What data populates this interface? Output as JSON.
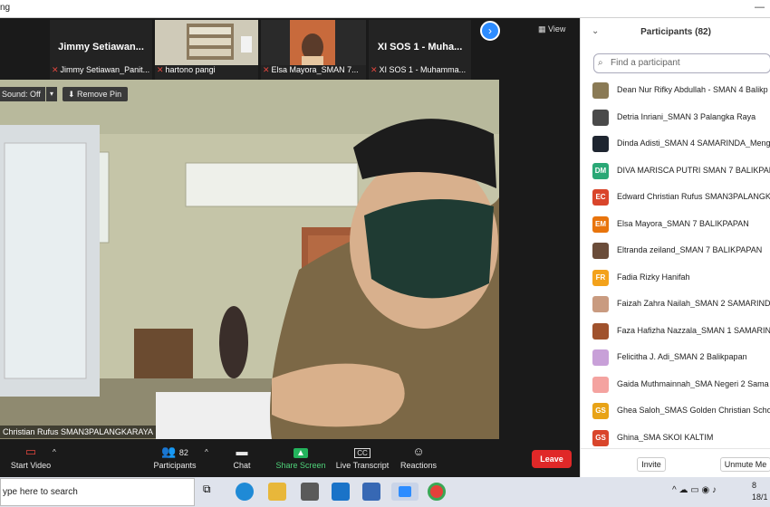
{
  "window": {
    "title": "ng",
    "controls": "—"
  },
  "thumbnails": [
    {
      "big_name": "Jimmy  Setiawan...",
      "caption": "Jimmy Setiawan_Panit...",
      "has_video": false
    },
    {
      "big_name": "",
      "caption": "hartono pangi",
      "has_video": true
    },
    {
      "big_name": "",
      "caption": "Elsa Mayora_SMAN 7...",
      "has_video": true
    },
    {
      "big_name": "XI SOS 1 - Muha...",
      "caption": "XI SOS 1 - Muhamma...",
      "has_video": false
    }
  ],
  "view_button": "View",
  "main_video": {
    "sound_label": "Sound: Off",
    "remove_pin": "Remove Pin",
    "speaker_name": "Christian Rufus SMAN3PALANGKARAYA"
  },
  "toolbar": {
    "start_video": "Start Video",
    "participants": "Participants",
    "participants_count": "82",
    "chat": "Chat",
    "share_screen": "Share Screen",
    "live_transcript": "Live Transcript",
    "reactions": "Reactions",
    "leave": "Leave"
  },
  "panel": {
    "title": "Participants (82)",
    "search_placeholder": "Find a participant",
    "invite": "Invite",
    "unmute_me": "Unmute Me",
    "participants": [
      {
        "name": "Dean Nur Rifky Abdullah - SMAN 4 Balikp",
        "initials": "",
        "color": "#8a7a55"
      },
      {
        "name": "Detria Inriani_SMAN 3 Palangka Raya",
        "initials": "",
        "color": "#4a4a4a"
      },
      {
        "name": "Dinda Adisti_SMAN 4 SAMARINDA_Meng",
        "initials": "",
        "color": "#1e2530"
      },
      {
        "name": "DIVA MARISCA PUTRI SMAN 7 BALIKPAPA",
        "initials": "DM",
        "color": "#2aa876"
      },
      {
        "name": "Edward Christian Rufus SMAN3PALANGK",
        "initials": "EC",
        "color": "#d9452b"
      },
      {
        "name": "Elsa Mayora_SMAN 7 BALIKPAPAN",
        "initials": "EM",
        "color": "#e8740c"
      },
      {
        "name": "Eltranda zeiland_SMAN 7 BALIKPAPAN",
        "initials": "",
        "color": "#6b4d3a"
      },
      {
        "name": "Fadia Rizky Hanifah",
        "initials": "FR",
        "color": "#f3a21b"
      },
      {
        "name": "Faizah Zahra Nailah_SMAN 2 SAMARIND",
        "initials": "",
        "color": "#c99b80"
      },
      {
        "name": "Faza Hafizha Nazzala_SMAN 1 SAMARIN",
        "initials": "",
        "color": "#a0522d"
      },
      {
        "name": "Felicitha J. Adi_SMAN 2 Balikpapan",
        "initials": "",
        "color": "#c8a0d8"
      },
      {
        "name": "Gaida Muthmainnah_SMA Negeri 2 Sama",
        "initials": "",
        "color": "#f4a3a0"
      },
      {
        "name": "Ghea Saloh_SMAS Golden Christian Scho",
        "initials": "GS",
        "color": "#e8a317"
      },
      {
        "name": "Ghina_SMA SKOI KALTIM",
        "initials": "GS",
        "color": "#d9452b"
      }
    ]
  },
  "taskbar": {
    "search_text": "ype here to search",
    "clock_time": "8",
    "clock_date": "18/1"
  }
}
